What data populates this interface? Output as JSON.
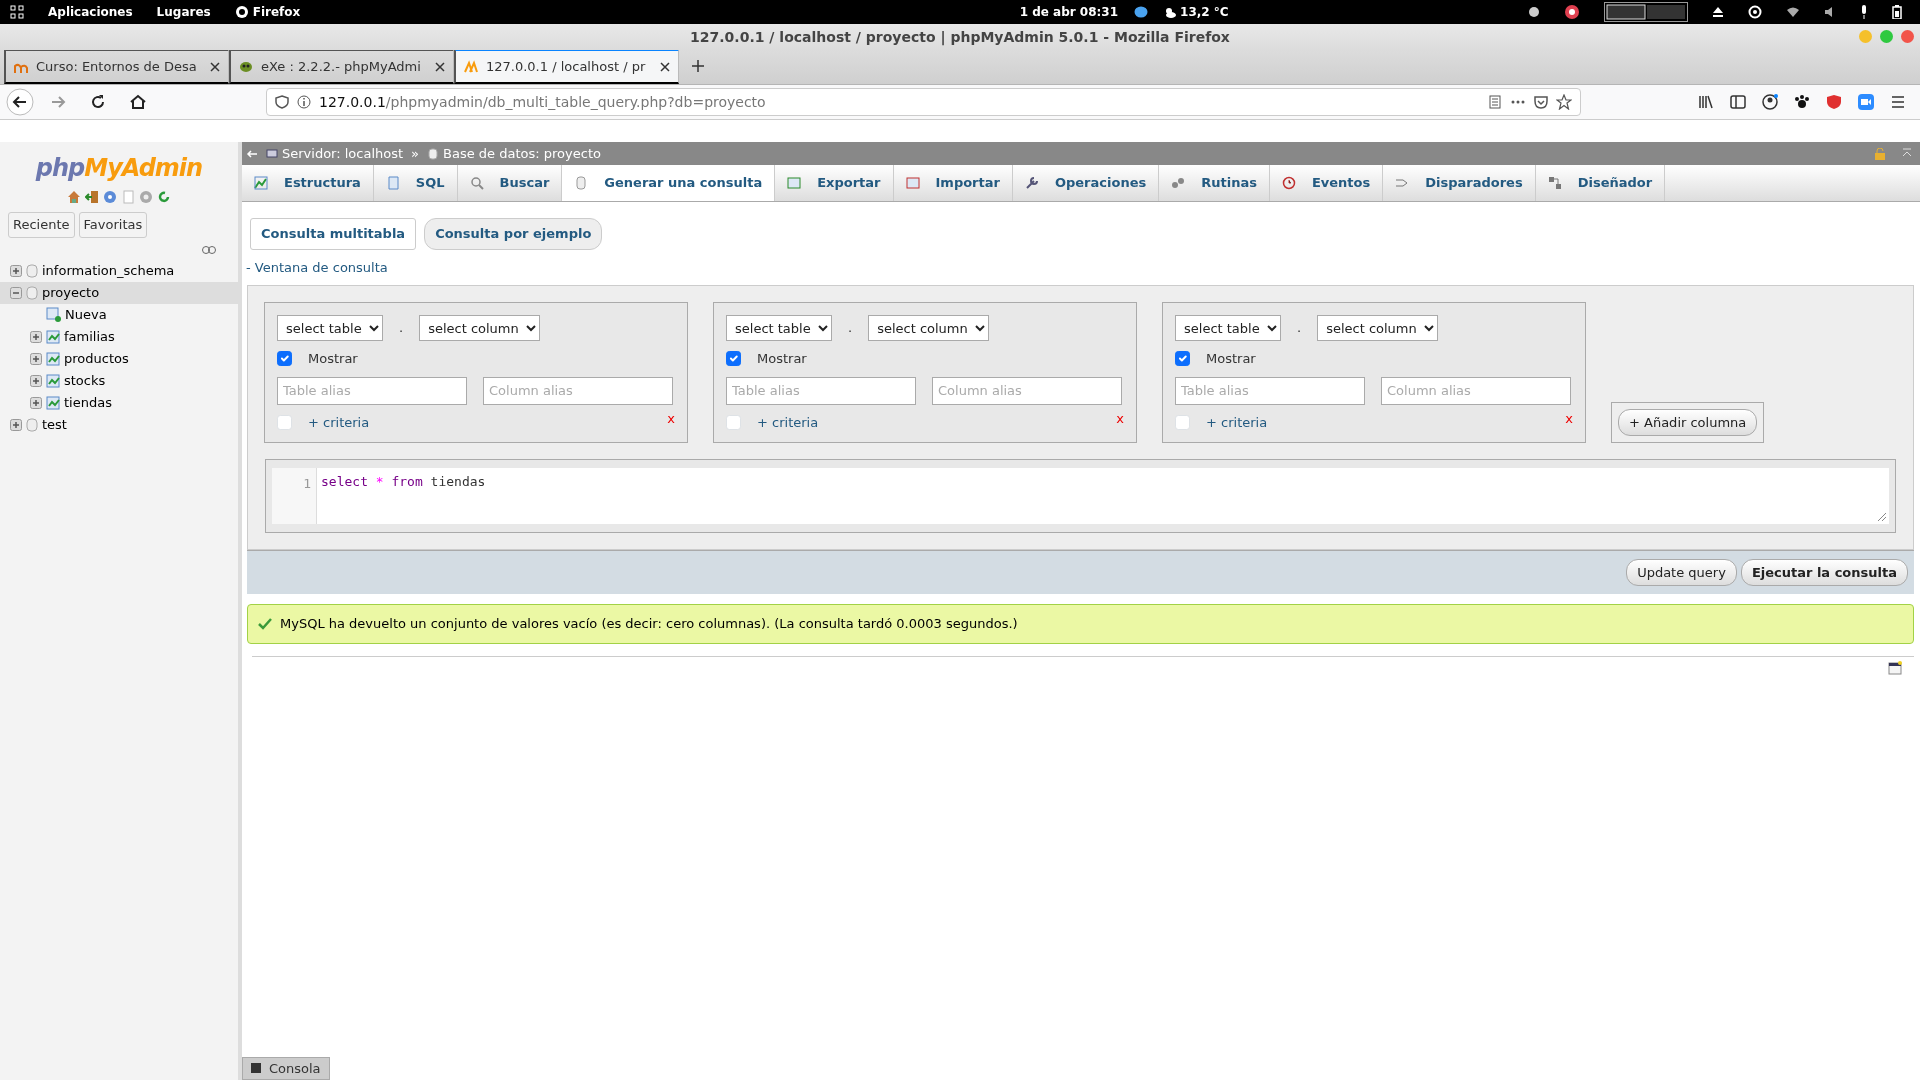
{
  "system_bar": {
    "menus": [
      "Aplicaciones",
      "Lugares",
      "Firefox"
    ],
    "clock": "1 de abr  08:31",
    "weather": "13,2 °C"
  },
  "window": {
    "title": "127.0.0.1 / localhost / proyecto | phpMyAdmin 5.0.1 - Mozilla Firefox"
  },
  "browser_tabs": [
    {
      "label": "Curso: Entornos de Desa",
      "selected": false
    },
    {
      "label": "eXe : 2.2.2.- phpMyAdmi",
      "selected": false
    },
    {
      "label": "127.0.0.1 / localhost / pr",
      "selected": true
    }
  ],
  "address_bar": {
    "host": "127.0.0.1",
    "path": "/phpmyadmin/db_multi_table_query.php?db=proyecto"
  },
  "sidebar": {
    "logo": {
      "first": "php",
      "second": "MyAdmin"
    },
    "buttons": [
      "Reciente",
      "Favoritas"
    ],
    "tree": [
      {
        "label": "information_schema",
        "kind": "database",
        "expanded": false,
        "selected": false
      },
      {
        "label": "proyecto",
        "kind": "database",
        "expanded": true,
        "selected": true,
        "children": [
          {
            "label": "Nueva",
            "kind": "new"
          },
          {
            "label": "familias",
            "kind": "table",
            "expanded": false
          },
          {
            "label": "productos",
            "kind": "table",
            "expanded": false
          },
          {
            "label": "stocks",
            "kind": "table",
            "expanded": false
          },
          {
            "label": "tiendas",
            "kind": "table",
            "expanded": false
          }
        ]
      },
      {
        "label": "test",
        "kind": "database",
        "expanded": false,
        "selected": false
      }
    ]
  },
  "breadcrumb": [
    "Servidor: localhost",
    "Base de datos: proyecto"
  ],
  "breadcrumb_separator": "»",
  "tabs": [
    {
      "label": "Estructura",
      "selected": false
    },
    {
      "label": "SQL",
      "selected": false
    },
    {
      "label": "Buscar",
      "selected": false
    },
    {
      "label": "Generar una consulta",
      "selected": true
    },
    {
      "label": "Exportar",
      "selected": false
    },
    {
      "label": "Importar",
      "selected": false
    },
    {
      "label": "Operaciones",
      "selected": false
    },
    {
      "label": "Rutinas",
      "selected": false
    },
    {
      "label": "Eventos",
      "selected": false
    },
    {
      "label": "Disparadores",
      "selected": false
    },
    {
      "label": "Diseñador",
      "selected": false
    }
  ],
  "subtabs": [
    {
      "label": "Consulta multitabla",
      "selected": true
    },
    {
      "label": "Consulta por ejemplo",
      "selected": false
    }
  ],
  "query_window_link": "- Ventana de consulta",
  "columns": [
    {
      "table_select": "select table",
      "separator": ".",
      "column_select": "select column",
      "show_label": "Mostrar",
      "show_checked": true,
      "table_alias_placeholder": "Table alias",
      "column_alias_placeholder": "Column alias",
      "criteria_label": "+ criteria",
      "criteria_checked": false,
      "remove": "x"
    },
    {
      "table_select": "select table",
      "separator": ".",
      "column_select": "select column",
      "show_label": "Mostrar",
      "show_checked": true,
      "table_alias_placeholder": "Table alias",
      "column_alias_placeholder": "Column alias",
      "criteria_label": "+ criteria",
      "criteria_checked": false,
      "remove": "x"
    },
    {
      "table_select": "select table",
      "separator": ".",
      "column_select": "select column",
      "show_label": "Mostrar",
      "show_checked": true,
      "table_alias_placeholder": "Table alias",
      "column_alias_placeholder": "Column alias",
      "criteria_label": "+ criteria",
      "criteria_checked": false,
      "remove": "x"
    }
  ],
  "add_column_button": "+ Añadir columna",
  "editor": {
    "line_number": "1",
    "tokens": [
      {
        "text": "select",
        "kind": "keyword"
      },
      {
        "text": "*",
        "kind": "operator"
      },
      {
        "text": "from",
        "kind": "keyword"
      },
      {
        "text": "tiendas",
        "kind": "plain"
      }
    ]
  },
  "buttons": [
    {
      "label": "Update query",
      "kind": "secondary"
    },
    {
      "label": "Ejecutar la consulta",
      "kind": "primary"
    }
  ],
  "message": "MySQL ha devuelto un conjunto de valores vacío (es decir: cero columnas). (La consulta tardó 0.0003 segundos.)",
  "console": "Consola"
}
